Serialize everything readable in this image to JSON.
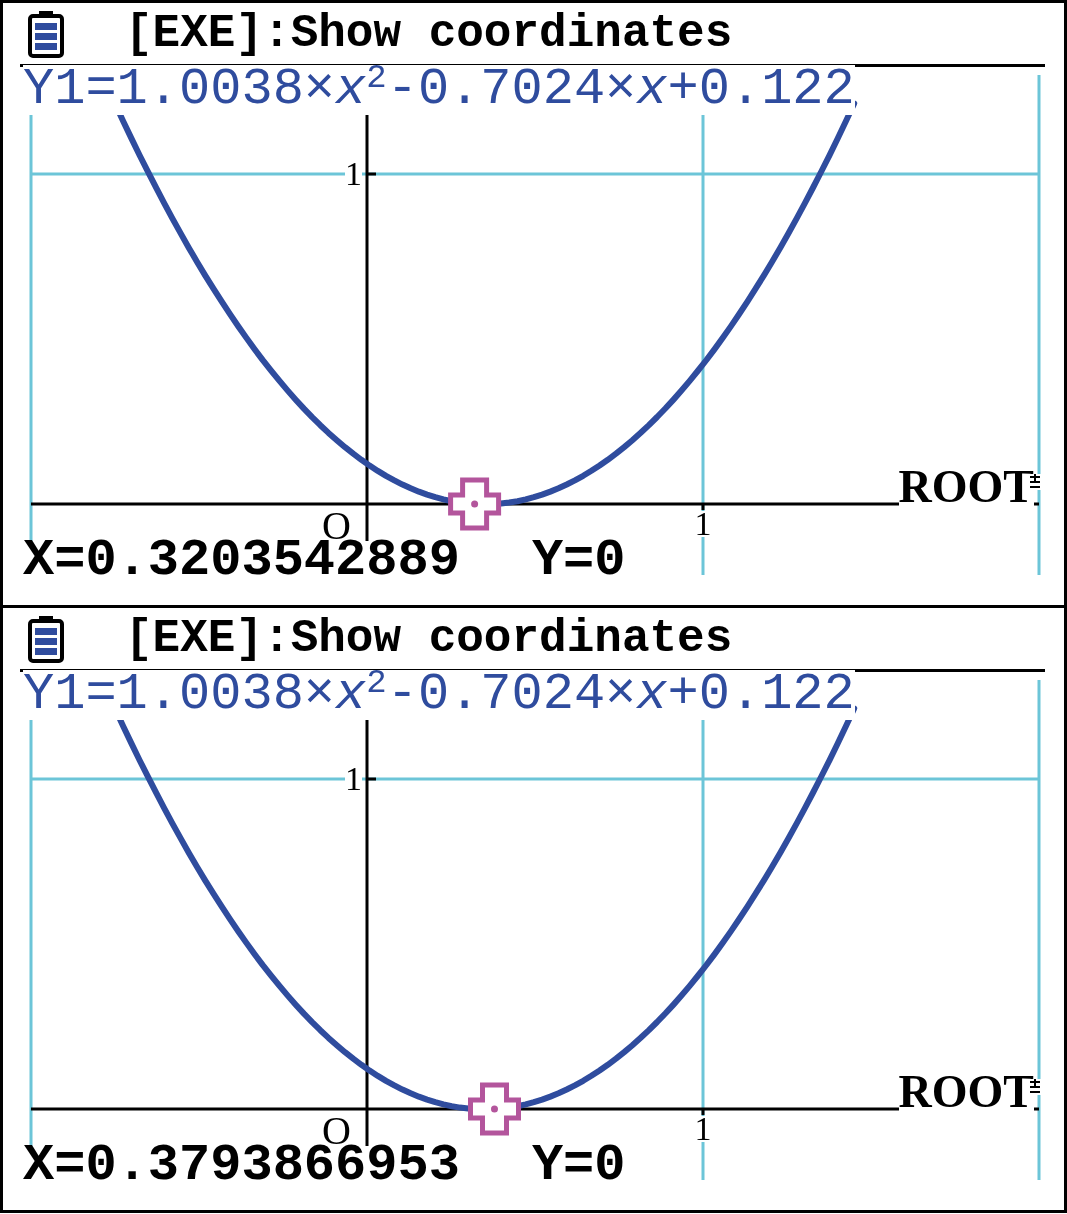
{
  "panels": [
    {
      "status": {
        "prompt": "[EXE]:Show coordinates"
      },
      "graph": {
        "function_label": "Y1=1.0038×*x*$^{2}$-0.7024×*x*+0.122",
        "y_tick_label": "1",
        "x_tick_label": "1",
        "origin_label": "O",
        "mode_label": "ROOT",
        "trace_cursor": {
          "level": 0.4401
        },
        "readout": {
          "x": "X=0.3203542889",
          "y": "Y=0"
        }
      }
    },
    {
      "status": {
        "prompt": "[EXE]:Show coordinates"
      },
      "graph": {
        "function_label": "Y1=1.0038×*x*$^{2}$-0.7024×*x*+0.122",
        "y_tick_label": "1",
        "x_tick_label": "1",
        "origin_label": "O",
        "mode_label": "ROOT",
        "trace_cursor": {
          "level": 0.4598
        },
        "readout": {
          "x": "X=0.3793866953",
          "y": "Y=0"
        }
      }
    }
  ]
}
